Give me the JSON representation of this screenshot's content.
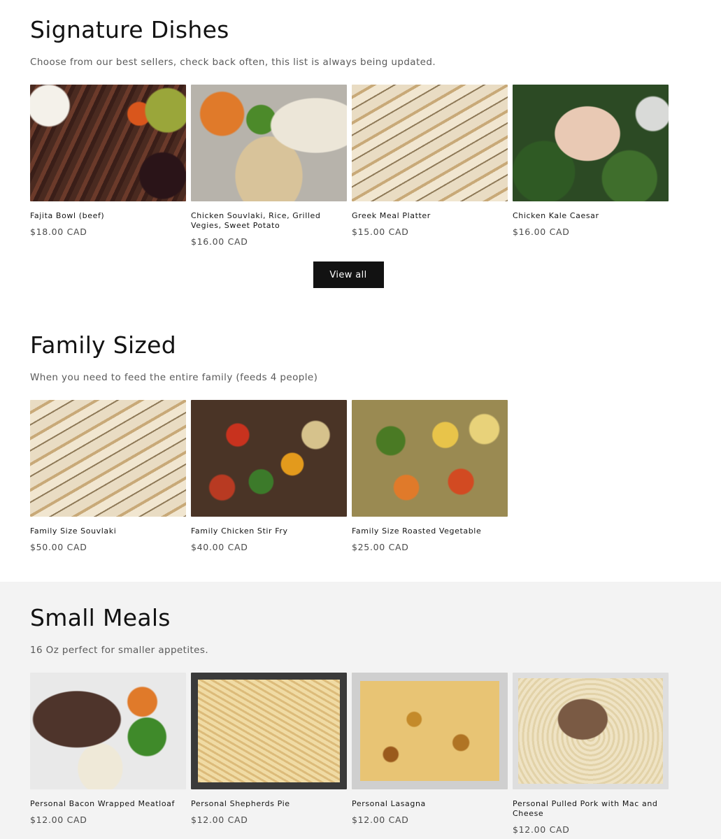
{
  "signature": {
    "title": "Signature Dishes",
    "description": "Choose from our best sellers, check back often, this list is always being updated.",
    "view_all_label": "View all",
    "products": [
      {
        "name": "Fajita Bowl (beef)",
        "price": "$18.00 CAD"
      },
      {
        "name": "Chicken Souvlaki, Rice, Grilled Vegies, Sweet Potato",
        "price": "$16.00 CAD"
      },
      {
        "name": "Greek Meal Platter",
        "price": "$15.00 CAD"
      },
      {
        "name": "Chicken Kale Caesar",
        "price": "$16.00 CAD"
      }
    ]
  },
  "family": {
    "title": "Family Sized",
    "description": "When you need to feed the entire family (feeds 4 people)",
    "products": [
      {
        "name": "Family Size Souvlaki",
        "price": "$50.00 CAD"
      },
      {
        "name": "Family Chicken Stir Fry",
        "price": "$40.00 CAD"
      },
      {
        "name": "Family Size Roasted Vegetable",
        "price": "$25.00 CAD"
      }
    ]
  },
  "small": {
    "title": "Small Meals",
    "description": "16 Oz perfect for smaller appetites.",
    "products": [
      {
        "name": "Personal Bacon Wrapped Meatloaf",
        "price": "$12.00 CAD"
      },
      {
        "name": "Personal Shepherds Pie",
        "price": "$12.00 CAD"
      },
      {
        "name": "Personal Lasagna",
        "price": "$12.00 CAD"
      },
      {
        "name": "Personal Pulled Pork with Mac and Cheese",
        "price": "$12.00 CAD"
      }
    ]
  },
  "colors": {
    "button_bg": "#121212",
    "grey_section_bg": "#f3f3f3",
    "price_text": "#4a4a4a"
  }
}
